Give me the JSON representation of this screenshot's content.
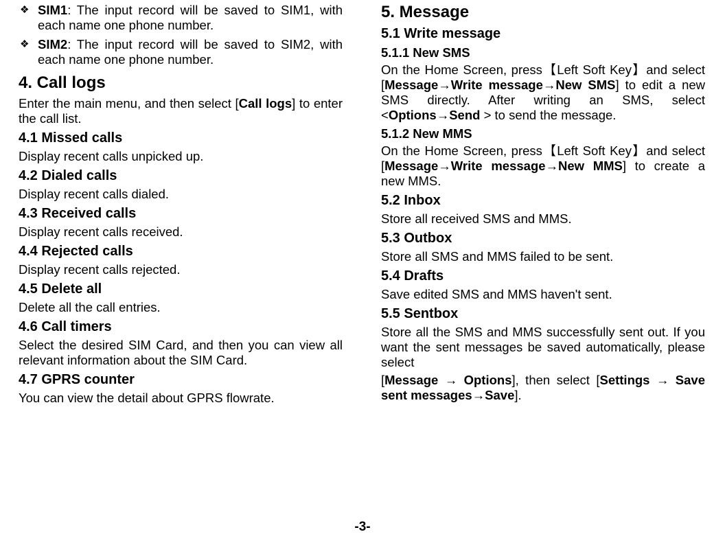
{
  "left": {
    "sim1_title": "SIM1",
    "sim1_body": ": The input record will be saved to SIM1, with each name one phone number.",
    "sim2_title": "SIM2",
    "sim2_body": ": The input record will be saved to SIM2, with each name one phone number.",
    "c4_title": "4. Call logs",
    "c4_intro_a": "Enter the main menu, and then select [",
    "c4_intro_bold": "Call logs",
    "c4_intro_b": "] to enter the call list.",
    "s41": "4.1 Missed calls",
    "s41_body": "Display recent calls unpicked up.",
    "s42": "4.2 Dialed calls",
    "s42_body": "Display recent calls dialed.",
    "s43": "4.3 Received calls",
    "s43_body": "Display recent calls received.",
    "s44": "4.4 Rejected calls",
    "s44_body": "Display recent calls rejected.",
    "s45": "4.5 Delete all",
    "s45_body": "Delete all the call entries.",
    "s46": "4.6 Call timers",
    "s46_body": "Select the desired SIM Card, and then you can view all relevant information about the SIM Card.",
    "s47": "4.7 GPRS counter",
    "s47_body": "You can view the detail about GPRS flowrate."
  },
  "right": {
    "c5_title": "5. Message",
    "s51": "5.1 Write message",
    "s511": "5.1.1 New SMS",
    "s511_a": "On the Home Screen, press【Left Soft Key】and select [",
    "s511_b1": "Message",
    "s511_arrow": "→",
    "s511_b2": "Write message",
    "s511_b3": "New SMS",
    "s511_c": "] to edit a new SMS directly. After writing an SMS, select <",
    "s511_b4": "Options",
    "s511_b5": "Send",
    "s511_d": " > to send the message.",
    "s512": "5.1.2 New MMS",
    "s512_a": "On the Home Screen, press【Left Soft Key】and select [",
    "s512_b1": "Message",
    "s512_b2": "Write message",
    "s512_b3": "New MMS",
    "s512_c": "] to create a new MMS.",
    "s52": "5.2 Inbox",
    "s52_body": "Store all received SMS and MMS.",
    "s53": "5.3 Outbox",
    "s53_body": "Store all SMS and MMS failed to be sent.",
    "s54": "5.4 Drafts",
    "s54_body": "Save edited SMS and MMS haven't sent.",
    "s55": "5.5 Sentbox",
    "s55_body": "Store all the SMS and MMS successfully sent out. If you want the sent messages be saved automatically, please select",
    "s55_path_a": "[",
    "s55_p1": "Message",
    "s55_p2": "Options",
    "s55_path_b": "], then select [",
    "s55_p3": "Settings",
    "s55_p4": "Save sent messages",
    "s55_p5": "Save",
    "s55_path_c": "]."
  },
  "pagenum": "-3-",
  "glyph": {
    "diamond": "❖"
  }
}
